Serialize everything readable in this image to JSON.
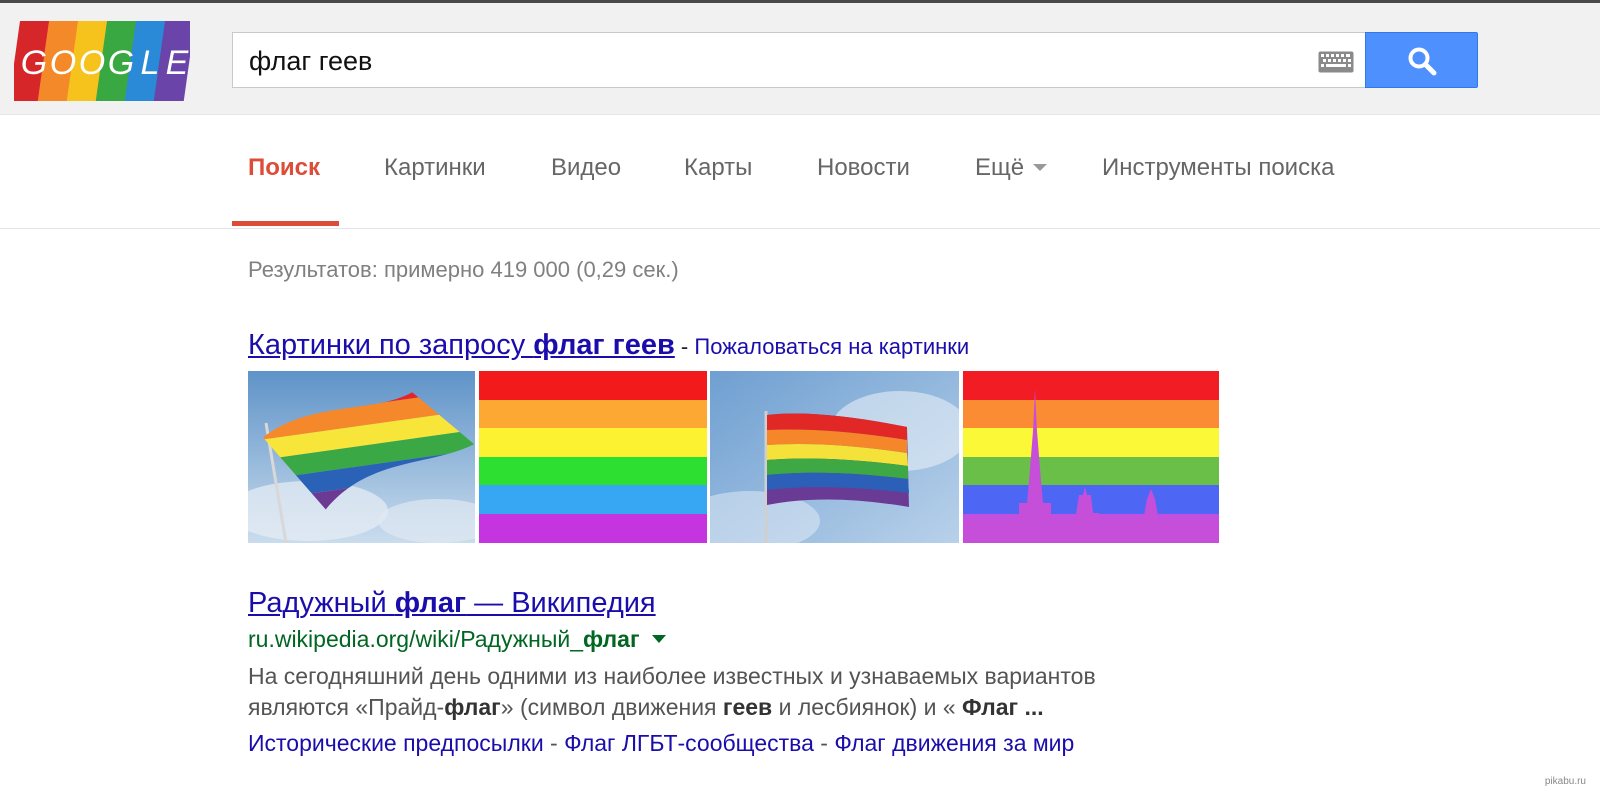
{
  "logo": {
    "letters": [
      "G",
      "O",
      "O",
      "G",
      "L",
      "E"
    ],
    "stripe_colors": [
      "#e2231a",
      "#f68b1f",
      "#f9c80e",
      "#3bab3b",
      "#1d88d8",
      "#6b3fa0"
    ]
  },
  "search": {
    "query": "флаг геев"
  },
  "tabs": [
    {
      "label": "Поиск",
      "active": true
    },
    {
      "label": "Картинки"
    },
    {
      "label": "Видео"
    },
    {
      "label": "Карты"
    },
    {
      "label": "Новости"
    },
    {
      "label": "Ещё"
    },
    {
      "label": "Инструменты поиска"
    }
  ],
  "stats": "Результатов: примерно 419 000 (0,29 сек.)",
  "images_block": {
    "title_prefix": "Картинки по запросу ",
    "title_bold": "флаг геев",
    "separator": " - ",
    "report_link": "Пожаловаться на картинки"
  },
  "result": {
    "title_parts": [
      "Радужный ",
      "флаг",
      " — Википедия"
    ],
    "url_parts": [
      "ru.wikipedia.org/wiki/Радужный_",
      "флаг"
    ],
    "snippet_line1": "На сегодняшний день одними из наиболее известных и узнаваемых вариантов",
    "snippet_line2_parts": [
      "являются «Прайд-",
      "флаг",
      "» (символ движения ",
      "геев",
      " и лесбиянок) и « ",
      "Флаг ..."
    ],
    "sitelinks": [
      "Исторические предпосылки",
      "Флаг ЛГБТ-сообщества",
      "Флаг движения за мир"
    ],
    "sitelink_separator": " - "
  },
  "rainbow": [
    "#e40303",
    "#ff8c00",
    "#ffed00",
    "#008026",
    "#24408e",
    "#732982"
  ],
  "flag_bands": [
    "#f21a1a",
    "#fca833",
    "#fdf232",
    "#2ddf30",
    "#37a7f4",
    "#c435e0"
  ],
  "spb_bands": [
    "#f21d24",
    "#fb8c33",
    "#fbf838",
    "#6abf48",
    "#4d67f4",
    "#c34fde"
  ],
  "watermark": "pikabu.ru"
}
